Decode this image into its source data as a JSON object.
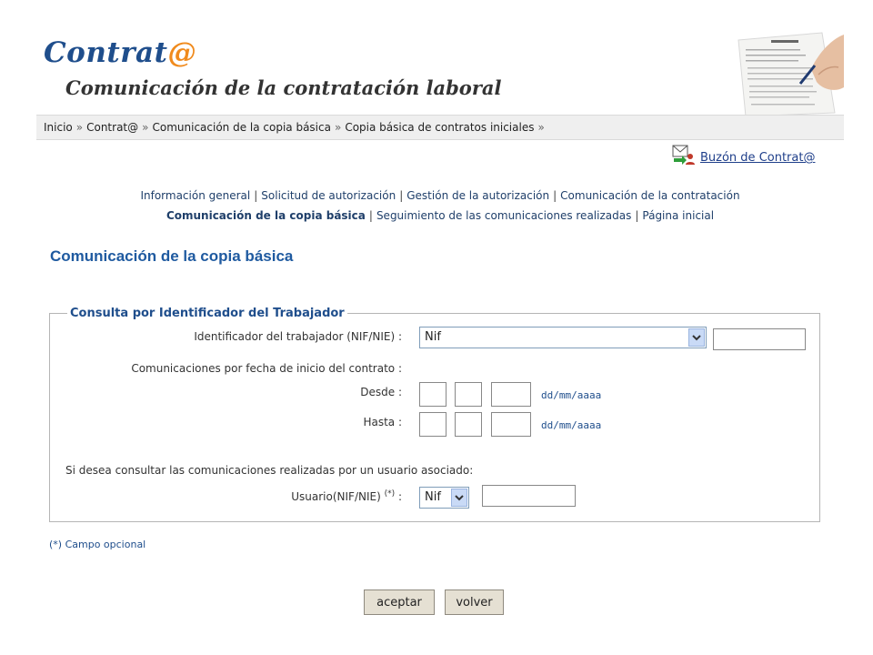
{
  "header": {
    "logo_word": "Contrat",
    "logo_at": "@",
    "subtitle": "Comunicación de la contratación laboral",
    "photo_icon": "hand-signing-contract-image"
  },
  "breadcrumb": [
    "Inicio",
    "Contrat@",
    "Comunicación de la copia básica",
    "Copia básica de contratos iniciales"
  ],
  "breadcrumb_separator": "»",
  "mailbox": {
    "icon": "mailbox-user-icon",
    "label": "Buzón de Contrat@"
  },
  "nav": {
    "row1": [
      "Información general",
      "Solicitud de autorización",
      "Gestión de la autorización",
      "Comunicación de la contratación"
    ],
    "row2": [
      "Comunicación de la copia básica",
      "Seguimiento de las comunicaciones realizadas",
      "Página inicial"
    ],
    "divider": "|",
    "active": "Comunicación de la copia básica"
  },
  "page_title": "Comunicación de la copia básica",
  "form": {
    "legend": "Consulta por Identificador del Trabajador",
    "worker_id_label": "Identificador del trabajador (NIF/NIE) :",
    "worker_id_type": "Nif",
    "worker_id_value": "",
    "date_section_label": "Comunicaciones por fecha de inicio del contrato :",
    "desde_label": "Desde :",
    "hasta_label": "Hasta :",
    "date_format": "dd/mm/aaaa",
    "desde_day": "",
    "desde_month": "",
    "desde_year": "",
    "hasta_day": "",
    "hasta_month": "",
    "hasta_year": "",
    "associated_user_prompt": "Si desea consultar las comunicaciones realizadas por un usuario asociado:",
    "user_label": "Usuario(NIF/NIE)",
    "user_label_marker": "(*)",
    "user_label_colon": ":",
    "user_type": "Nif",
    "user_value": ""
  },
  "optional_note": "(*) Campo opcional",
  "buttons": {
    "accept": "aceptar",
    "back": "volver"
  },
  "colors": {
    "brand_blue": "#1f4e8c",
    "brand_orange": "#f08a1c",
    "title_blue": "#1f5aa0"
  }
}
